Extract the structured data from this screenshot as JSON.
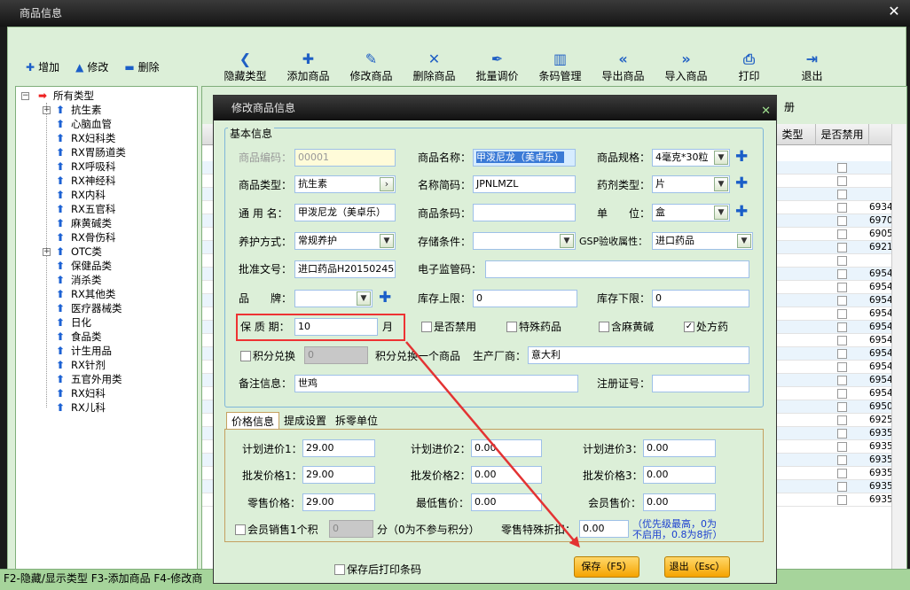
{
  "window": {
    "title": "商品信息",
    "close": "✕"
  },
  "toolbar_left": [
    {
      "icon": "plus-icon",
      "glyph": "✚",
      "label": "增加"
    },
    {
      "icon": "triangle-up-icon",
      "glyph": "▲",
      "label": "修改"
    },
    {
      "icon": "minus-icon",
      "glyph": "▬",
      "label": "删除"
    }
  ],
  "toolbar_main": [
    {
      "icon": "chevron-left-icon",
      "glyph": "❮",
      "label": "隐藏类型"
    },
    {
      "icon": "add-product-icon",
      "glyph": "✚",
      "label": "添加商品"
    },
    {
      "icon": "edit-product-icon",
      "glyph": "✎",
      "label": "修改商品"
    },
    {
      "icon": "delete-icon",
      "glyph": "✕",
      "label": "删除商品"
    },
    {
      "icon": "price-pen-icon",
      "glyph": "✒",
      "label": "批量调价"
    },
    {
      "icon": "barcode-icon",
      "glyph": "▥",
      "label": "条码管理"
    },
    {
      "icon": "double-left-icon",
      "glyph": "«",
      "label": "导出商品"
    },
    {
      "icon": "double-right-icon",
      "glyph": "»",
      "label": "导入商品"
    },
    {
      "icon": "printer-icon",
      "glyph": "⎙",
      "label": "打印"
    },
    {
      "icon": "exit-door-icon",
      "glyph": "⇥",
      "label": "退出"
    }
  ],
  "tree": {
    "root": "所有类型",
    "items": [
      "抗生素",
      "心脑血管",
      "RX妇科类",
      "RX胃肠道类",
      "RX呼吸科",
      "RX神经科",
      "RX内科",
      "RX五官科",
      "麻黄碱类",
      "RX骨伤科",
      "OTC类",
      "保健品类",
      "消杀类",
      "RX其他类",
      "医疗器械类",
      "日化",
      "食品类",
      "计生用品",
      "RX针剂",
      "五官外用类",
      "RX妇科",
      "RX儿科"
    ]
  },
  "grid": {
    "headers": [
      "类型",
      "是否禁用"
    ],
    "partial_header": "册",
    "codes": [
      "",
      "",
      "",
      "6934",
      "6970",
      "6905",
      "6921",
      "",
      "6954",
      "6954",
      "6954",
      "6954",
      "6954",
      "6954",
      "6954",
      "6954",
      "6954",
      "6954",
      "6950",
      "6925",
      "6935",
      "6935",
      "6935",
      "6935",
      "6935",
      "6935"
    ]
  },
  "status_bar": "F2-隐藏/显示类型   F3-添加商品  F4-修改商",
  "dialog": {
    "title": "修改商品信息",
    "close": "✕",
    "group_basic": "基本信息",
    "fields": {
      "code_label": "商品编码：",
      "code_value": "00001",
      "name_label": "商品名称：",
      "name_value": "甲泼尼龙（美卓乐）",
      "spec_label": "商品规格：",
      "spec_value": "4毫克*30粒",
      "type_label": "商品类型：",
      "type_value": "抗生素",
      "abbr_label": "名称简码：",
      "abbr_value": "JPNLMZL",
      "dosage_label": "药剂类型：",
      "dosage_value": "片",
      "generic_label": "通 用 名：",
      "generic_value": "甲泼尼龙（美卓乐）",
      "barcode_label": "商品条码：",
      "barcode_value": "",
      "unit_label": "单　　位：",
      "unit_value": "盒",
      "care_label": "养护方式：",
      "care_value": "常规养护",
      "storage_label": "存储条件：",
      "storage_value": "",
      "gsp_label": "GSP验收属性：",
      "gsp_value": "进口药品",
      "approval_label": "批准文号：",
      "approval_value": "进口药品H20150245",
      "supervise_label": "电子监管码：",
      "supervise_value": "",
      "brand_label": "品　　牌：",
      "brand_value": "",
      "stock_max_label": "库存上限：",
      "stock_max_value": "0",
      "stock_min_label": "库存下限：",
      "stock_min_value": "0",
      "shelf_label": "保 质 期：",
      "shelf_value": "10",
      "shelf_unit": "月",
      "disabled_label": "是否禁用",
      "special_label": "特殊药品",
      "ephedrine_label": "含麻黄碱",
      "rx_label": "处方药",
      "points_label": "积分兑换",
      "points_value": "0",
      "points_suffix": "积分兑换一个商品",
      "maker_label": "生产厂商：",
      "maker_value": "意大利",
      "remark_label": "备注信息：",
      "remark_value": "世鸡",
      "regno_label": "注册证号：",
      "regno_value": ""
    },
    "tabs": [
      "价格信息",
      "提成设置",
      "拆零单位"
    ],
    "price": {
      "plan1_label": "计划进价1：",
      "plan1_value": "29.00",
      "plan2_label": "计划进价2：",
      "plan2_value": "0.00",
      "plan3_label": "计划进价3：",
      "plan3_value": "0.00",
      "whole1_label": "批发价格1：",
      "whole1_value": "29.00",
      "whole2_label": "批发价格2：",
      "whole2_value": "0.00",
      "whole3_label": "批发价格3：",
      "whole3_value": "0.00",
      "retail_label": "零售价格：",
      "retail_value": "29.00",
      "min_label": "最低售价：",
      "min_value": "0.00",
      "member_label": "会员售价：",
      "member_value": "0.00",
      "member_points_label": "会员销售1个积",
      "member_points_value": "0",
      "member_points_suffix": "分（0为不参与积分）",
      "discount_label": "零售特殊折扣：",
      "discount_value": "0.00",
      "discount_note1": "（优先级最高，0为",
      "discount_note2": "不启用，0.8为8折）"
    },
    "print_after_save": "保存后打印条码",
    "save": "保存（F5）",
    "cancel": "退出（Esc）"
  },
  "colors": {
    "highlight_box": "#e33333",
    "arrow": "#e33333",
    "accent": "#1a5ec8"
  }
}
